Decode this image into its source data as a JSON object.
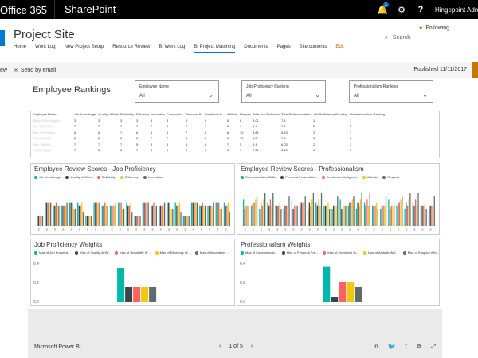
{
  "suitebar": {
    "app_label": "Office 365",
    "site_app": "SharePoint",
    "notifications_count": "1",
    "user_name": "Hingepoint Admi",
    "bell_icon": "bell-icon",
    "gear_icon": "gear-icon",
    "help_icon": "help-icon"
  },
  "site": {
    "title": "Project Site",
    "following_label": "Following",
    "search_placeholder": "Search",
    "nav": [
      "Home",
      "Work Log",
      "New Project Setup",
      "Resource Review",
      "BI Work Log",
      "BI Project Matching",
      "Documents",
      "Pages",
      "Site contents",
      "Edit"
    ],
    "active_nav": "BI Project Matching"
  },
  "cmdbar": {
    "view_label": "ew",
    "email_label": "Send by email",
    "published": "Published 11/11/2017"
  },
  "report": {
    "title": "Employee Rankings",
    "slicers": [
      {
        "label": "Employee Name",
        "value": "All"
      },
      {
        "label": "Job Proficiency Ranking",
        "value": "All"
      },
      {
        "label": "Professionalism Ranking",
        "value": "All"
      }
    ],
    "table": {
      "headers": [
        "Employee Name",
        "Job Knowledge",
        "Quality of Work",
        "Reliability",
        "Efficiency",
        "Innovation",
        "Communic...",
        "Personal P...",
        "Emotional In...",
        "Attitude",
        "Respect",
        "Total Job Proficiency",
        "Total Professionalism",
        "Job Proficiency Ranking",
        "Professionalism Ranking"
      ],
      "rows": [
        [
          "Ashley Ann Rogers",
          "3",
          "3",
          "3",
          "3",
          "3",
          "8",
          "5",
          "6",
          "6",
          "6",
          "3.01",
          "7.4",
          "1",
          "1"
        ],
        [
          "Ben Simmons",
          "7",
          "7",
          "7",
          "7",
          "7",
          "6",
          "7",
          "7",
          "8",
          "9",
          "6.7",
          "7.1",
          "2",
          "2"
        ],
        [
          "Blair Thompson",
          "6",
          "6",
          "7",
          "6",
          "6",
          "5",
          "7",
          "6",
          "8",
          "10",
          "5.81",
          "6.43",
          "2",
          "3"
        ],
        [
          "Chad Goodin",
          "6",
          "6",
          "6",
          "6",
          "7",
          "7",
          "6",
          "8",
          "6",
          "10",
          "6.2",
          "7.6",
          "3",
          "2"
        ],
        [
          "Kate Tillman",
          "7",
          "7",
          "7",
          "5",
          "5",
          "6",
          "6",
          "6",
          "7",
          "5",
          "6.4",
          "6.03",
          "2",
          "2"
        ],
        [
          "Kristen Blake",
          "7",
          "6",
          "6",
          "7",
          "4",
          "5",
          "6",
          "6",
          "6",
          "9",
          "7.21",
          "8.15",
          "4",
          "3"
        ]
      ]
    },
    "panels": {
      "review_job": {
        "title": "Employee Review Scores - Job Proficiency",
        "legend": [
          "Job Knowledge",
          "Quality of Work",
          "Reliability",
          "Efficiency",
          "Innovation"
        ]
      },
      "review_prof": {
        "title": "Employee Review Scores - Professionalism",
        "legend": [
          "Communication Skills",
          "Personal Presentation",
          "Emotional Intelligence",
          "Attitude",
          "Respect"
        ]
      },
      "weights_job": {
        "title": "Job Proficiency Weights",
        "legend": [
          "Max of Job Knowled...",
          "Max of Quality of W...",
          "Max of Reliability W...",
          "Max of Efficiency W...",
          "Max of Innovation ..."
        ]
      },
      "weights_prof": {
        "title": "Professionalism Weights",
        "legend": [
          "Max of Communicati...",
          "Max of Personal Pre...",
          "Max of Emotional In...",
          "Max of Attitude Wei...",
          "Max of Respect Wei..."
        ]
      }
    },
    "series_colors": [
      "#01b8aa",
      "#374649",
      "#fd625e",
      "#f2c80f",
      "#5f6b6d"
    ]
  },
  "chart_data": [
    {
      "type": "bar",
      "title": "Job Proficiency Weights",
      "categories": [
        "Max of Job Knowled...",
        "Max of Quality of W...",
        "Max of Reliability W...",
        "Max of Efficiency W...",
        "Max of Innovation ..."
      ],
      "values": [
        0.35,
        0.15,
        0.15,
        0.15,
        0.15
      ],
      "ylim": [
        0,
        0.4
      ],
      "yticks": [
        "0.4",
        "0.2",
        "0.0"
      ]
    },
    {
      "type": "bar",
      "title": "Professionalism Weights",
      "categories": [
        "Max of Communicati...",
        "Max of Personal Pre...",
        "Max of Emotional In...",
        "Max of Attitude Wei...",
        "Max of Respect Wei..."
      ],
      "values": [
        0.37,
        0.05,
        0.2,
        0.2,
        0.15
      ],
      "ylim": [
        0,
        0.4
      ],
      "yticks": [
        "0.4",
        "0.2",
        "0.0"
      ]
    }
  ],
  "footer": {
    "brand": "Microsoft Power BI",
    "page_label": "1 of 5",
    "prev_icon": "chevron-left-icon",
    "next_icon": "chevron-right-icon"
  }
}
